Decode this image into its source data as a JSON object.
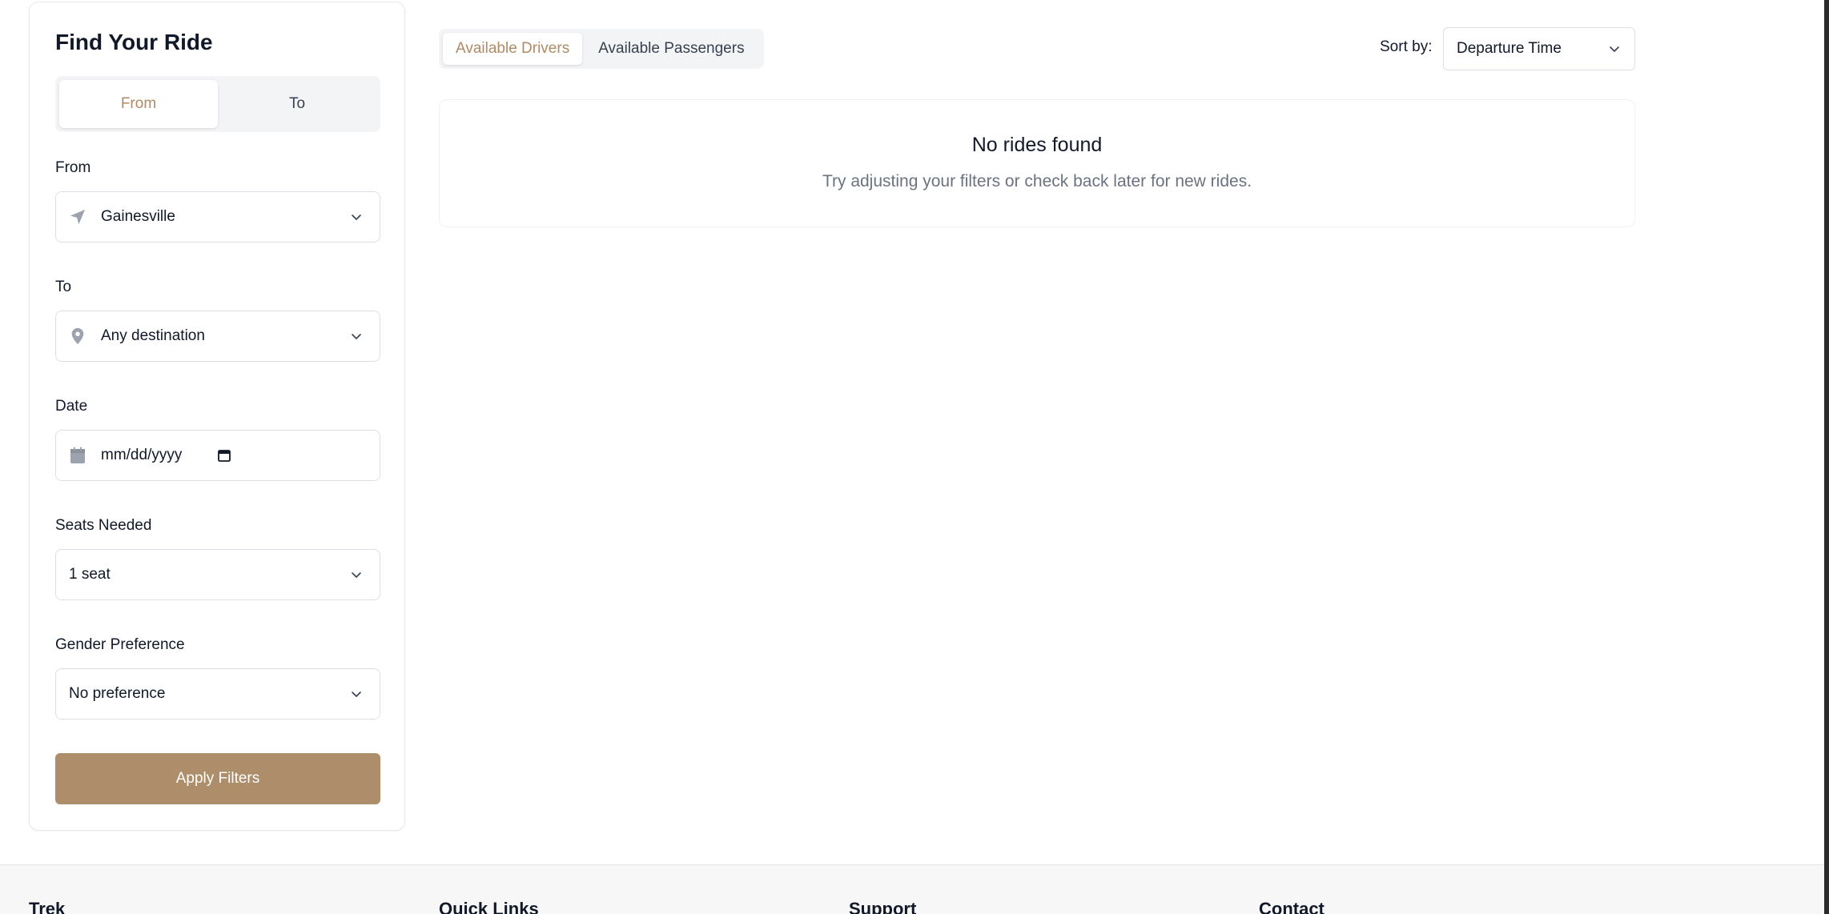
{
  "sidebar": {
    "title": "Find Your Ride",
    "direction_toggle": {
      "options": [
        "From",
        "To"
      ],
      "active": "From"
    },
    "from": {
      "label": "From",
      "value": "Gainesville",
      "icon": "navigation-arrow-icon"
    },
    "to": {
      "label": "To",
      "value": "Any destination",
      "icon": "map-pin-icon"
    },
    "date": {
      "label": "Date",
      "placeholder": "mm/dd/yyyy",
      "icon": "calendar-icon"
    },
    "seats": {
      "label": "Seats Needed",
      "value": "1 seat"
    },
    "gender": {
      "label": "Gender Preference",
      "value": "No preference"
    },
    "apply_label": "Apply Filters"
  },
  "main": {
    "tabs": [
      {
        "label": "Available Drivers",
        "active": true
      },
      {
        "label": "Available Passengers",
        "active": false
      }
    ],
    "sort": {
      "label": "Sort by:",
      "value": "Departure Time"
    },
    "empty": {
      "title": "No rides found",
      "subtitle": "Try adjusting your filters or check back later for new rides."
    }
  },
  "footer": {
    "columns": [
      "Trek",
      "Quick Links",
      "Support",
      "Contact"
    ]
  },
  "colors": {
    "accent": "#ad8d6a",
    "accent_text": "#b08a64",
    "muted_text": "#6b7280",
    "icon_gray": "#9ca3af"
  }
}
